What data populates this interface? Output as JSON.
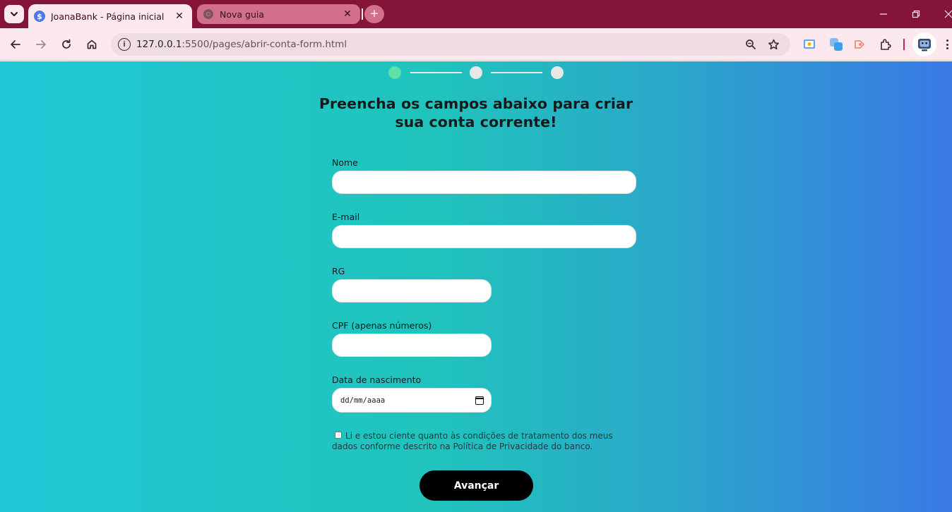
{
  "browser": {
    "tabs": [
      {
        "title": "JoanaBank - Página inicial",
        "favicon": "dollar-icon",
        "active": true
      },
      {
        "title": "Nova guia",
        "favicon": "chrome-icon",
        "active": false
      }
    ],
    "address_bar": {
      "host": "127.0.0.1",
      "path": ":5500/pages/abrir-conta-form.html"
    },
    "colors": {
      "frame": "#841538",
      "toolbar": "#fbe9ee",
      "omnibox": "#f0dde3"
    }
  },
  "page": {
    "stepper": {
      "total_steps": 3,
      "current_step": 1,
      "colors": {
        "active": "#5ee0a6",
        "inactive": "#e7e7e7"
      }
    },
    "heading": "Preencha os campos abaixo para criar sua conta corrente!",
    "fields": {
      "nome": {
        "label": "Nome",
        "value": ""
      },
      "email": {
        "label": "E-mail",
        "value": ""
      },
      "rg": {
        "label": "RG",
        "value": ""
      },
      "cpf": {
        "label": "CPF (apenas números)",
        "value": ""
      },
      "nascimento": {
        "label": "Data de nascimento",
        "placeholder": "dd/mm/aaaa"
      }
    },
    "consent": {
      "checked": false,
      "text": "Li e estou ciente quanto às condições de tratamento dos meus dados conforme descrito na Política de Privacidade do banco."
    },
    "submit_label": "Avançar",
    "colors": {
      "gradient_start": "#1fc8d6",
      "gradient_end": "#3a78e6",
      "button": "#000000"
    }
  }
}
